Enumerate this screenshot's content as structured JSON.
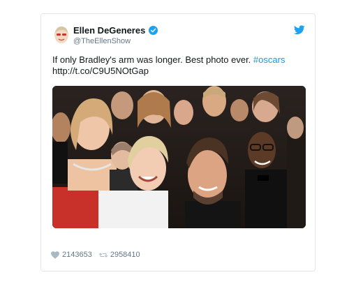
{
  "tweet": {
    "author_name": "Ellen DeGeneres",
    "author_handle": "@TheEllenShow",
    "text_main": "If only Bradley's arm was longer. Best photo ever.",
    "hashtag": "#oscars",
    "link": "http://t.co/C9U5NOtGap",
    "likes": "2143653",
    "retweets": "2958410"
  },
  "icons": {
    "verified": "verified-badge-icon",
    "bird": "twitter-bird-icon",
    "like": "heart-icon",
    "retweet": "retweet-icon"
  },
  "colors": {
    "link": "#1b95e0",
    "verified": "#1da1f2",
    "muted": "#657786"
  }
}
